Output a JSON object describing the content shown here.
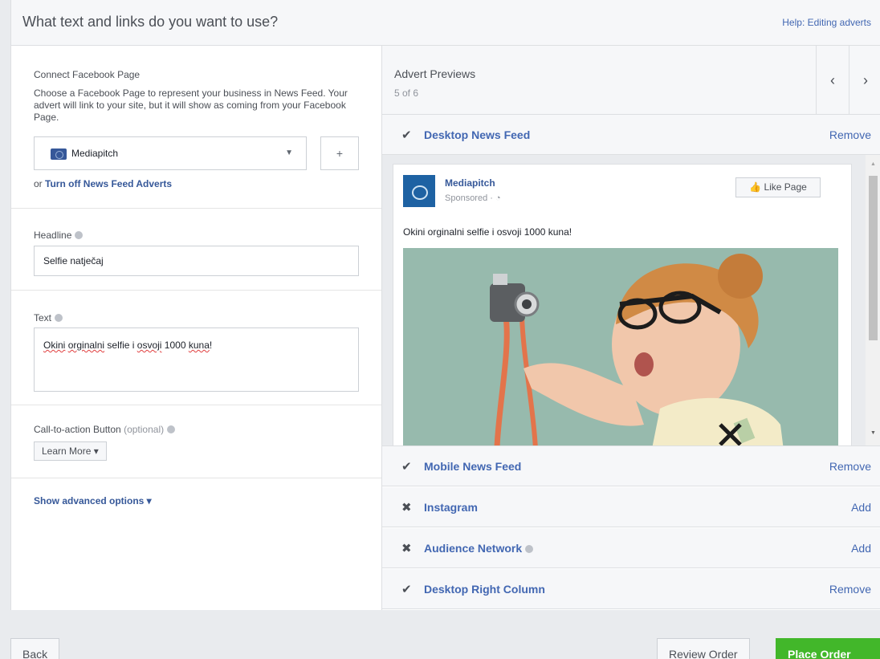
{
  "header": {
    "title": "What text and links do you want to use?",
    "help": "Help: Editing adverts"
  },
  "connect": {
    "label": "Connect Facebook Page",
    "description": "Choose a Facebook Page to represent your business in News Feed. Your advert will link to your site, but it will show as coming from your Facebook Page.",
    "selected_page": "Mediapitch",
    "add_label": "+",
    "or_text": "or",
    "turn_off_link": "Turn off News Feed Adverts"
  },
  "headline": {
    "label": "Headline",
    "value": "Selfie natječaj"
  },
  "text": {
    "label": "Text",
    "words": [
      "Okini",
      "orginalni",
      "selfie i",
      "osvoji",
      "1000",
      "kuna",
      "!"
    ]
  },
  "cta": {
    "label": "Call-to-action Button",
    "optional": "(optional)",
    "value": "Learn More ▾"
  },
  "advanced": {
    "label": "Show advanced options ▾"
  },
  "previews": {
    "title": "Advert Previews",
    "count": "5 of 6",
    "prev_arrow": "‹",
    "next_arrow": "›",
    "placements": [
      {
        "icon": "✔",
        "name": "Desktop News Feed",
        "action": "Remove"
      },
      {
        "icon": "✔",
        "name": "Mobile News Feed",
        "action": "Remove"
      },
      {
        "icon": "✖",
        "name": "Instagram",
        "action": "Add"
      },
      {
        "icon": "✖",
        "name": "Audience Network",
        "action": "Add"
      },
      {
        "icon": "✔",
        "name": "Desktop Right Column",
        "action": "Remove"
      }
    ]
  },
  "ad": {
    "page_name": "Mediapitch",
    "sponsored": "Sponsored · ◔",
    "like_label": "👍 Like Page",
    "message": "Okini orginalni selfie i osvoji 1000 kuna!"
  },
  "footer": {
    "back": "Back",
    "review": "Review Order",
    "place": "Place Order"
  },
  "colors": {
    "link": "#4267b2",
    "green": "#42b72a",
    "border": "#dddfe2"
  }
}
